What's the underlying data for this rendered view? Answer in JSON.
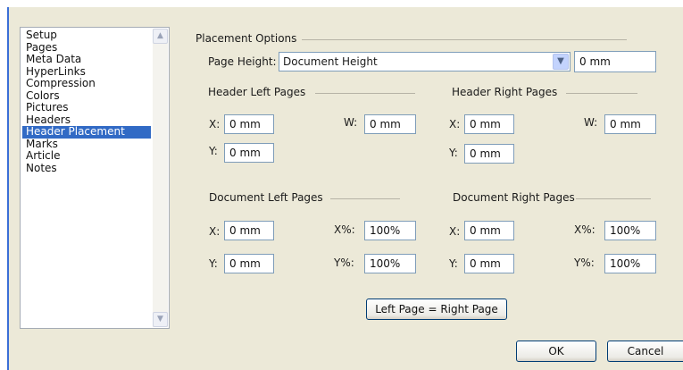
{
  "nav": {
    "items": [
      {
        "label": "Setup"
      },
      {
        "label": "Pages"
      },
      {
        "label": "Meta Data"
      },
      {
        "label": "HyperLinks"
      },
      {
        "label": "Compression"
      },
      {
        "label": "Colors"
      },
      {
        "label": "Pictures"
      },
      {
        "label": "Headers"
      },
      {
        "label": "Header Placement",
        "selected": true
      },
      {
        "label": "Marks"
      },
      {
        "label": "Article"
      },
      {
        "label": "Notes"
      }
    ]
  },
  "placement": {
    "title": "Placement Options",
    "page_height_label": "Page Height:",
    "page_height_select": "Document Height",
    "page_height_value": "0 mm"
  },
  "header_left": {
    "title": "Header Left Pages",
    "x_label": "X:",
    "x_value": "0 mm",
    "y_label": "Y:",
    "y_value": "0 mm",
    "w_label": "W:",
    "w_value": "0 mm"
  },
  "header_right": {
    "title": "Header Right Pages",
    "x_label": "X:",
    "x_value": "0 mm",
    "y_label": "Y:",
    "y_value": "0 mm",
    "w_label": "W:",
    "w_value": "0 mm"
  },
  "doc_left": {
    "title": "Document Left Pages",
    "x_label": "X:",
    "x_value": "0 mm",
    "y_label": "Y:",
    "y_value": "0 mm",
    "xp_label": "X%:",
    "xp_value": "100%",
    "yp_label": "Y%:",
    "yp_value": "100%"
  },
  "doc_right": {
    "title": "Document Right Pages",
    "x_label": "X:",
    "x_value": "0 mm",
    "y_label": "Y:",
    "y_value": "0 mm",
    "xp_label": "X%:",
    "xp_value": "100%",
    "yp_label": "Y%:",
    "yp_value": "100%"
  },
  "buttons": {
    "left_eq_right": "Left Page = Right Page",
    "ok": "OK",
    "cancel": "Cancel"
  },
  "icons": {
    "scroll_up": "chevron-up-icon",
    "scroll_down": "chevron-down-icon",
    "dropdown": "chevron-down-icon"
  },
  "colors": {
    "selection": "#316ac5",
    "dialog_bg": "#ece9d8",
    "accent_border": "#3b6fd6"
  }
}
